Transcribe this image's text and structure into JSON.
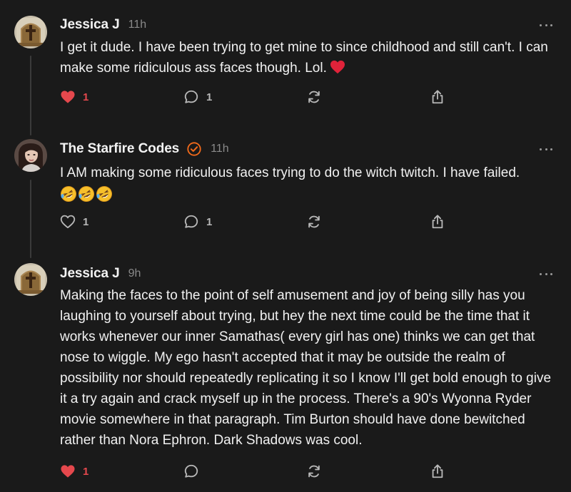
{
  "posts": [
    {
      "author": "Jessica J",
      "time": "11h",
      "verified": false,
      "avatar_icon": "cross-plaque-icon",
      "text": "I get it dude. I have been trying to get mine to since childhood and still can't. I can make some ridiculous ass faces though. Lol.",
      "trailing_emoji": "red-heart-icon",
      "likes": "1",
      "liked": true,
      "replies": "1"
    },
    {
      "author": "The Starfire Codes",
      "time": "11h",
      "verified": true,
      "avatar_icon": "profile-photo-icon",
      "text": "I AM making some ridiculous faces trying to do the witch twitch. I have failed.",
      "trailing_emoji": "rolling-on-floor-laughing-icon x3",
      "likes": "1",
      "liked": false,
      "replies": "1"
    },
    {
      "author": "Jessica J",
      "time": "9h",
      "verified": false,
      "avatar_icon": "cross-plaque-icon",
      "text": "Making the faces to the point of self amusement and joy of being silly has you laughing to yourself about trying, but hey the next time could be the time that it works whenever our inner Samathas( every girl has one) thinks we can get that nose to wiggle. My ego hasn't accepted that it may be outside the realm of possibility nor should repeatedly replicating it so I know I'll get bold enough to give it a try again and crack myself up in the process. There's a 90's Wyonna Ryder movie somewhere in that paragraph. Tim Burton should have done bewitched rather than Nora Ephron. Dark Shadows was cool.",
      "likes": "1",
      "liked": true,
      "replies": ""
    }
  ],
  "colors": {
    "background": "#1a1a1a",
    "like_red": "#e5484d",
    "verified_orange": "#f26a1b",
    "muted": "#8a8a8a"
  }
}
